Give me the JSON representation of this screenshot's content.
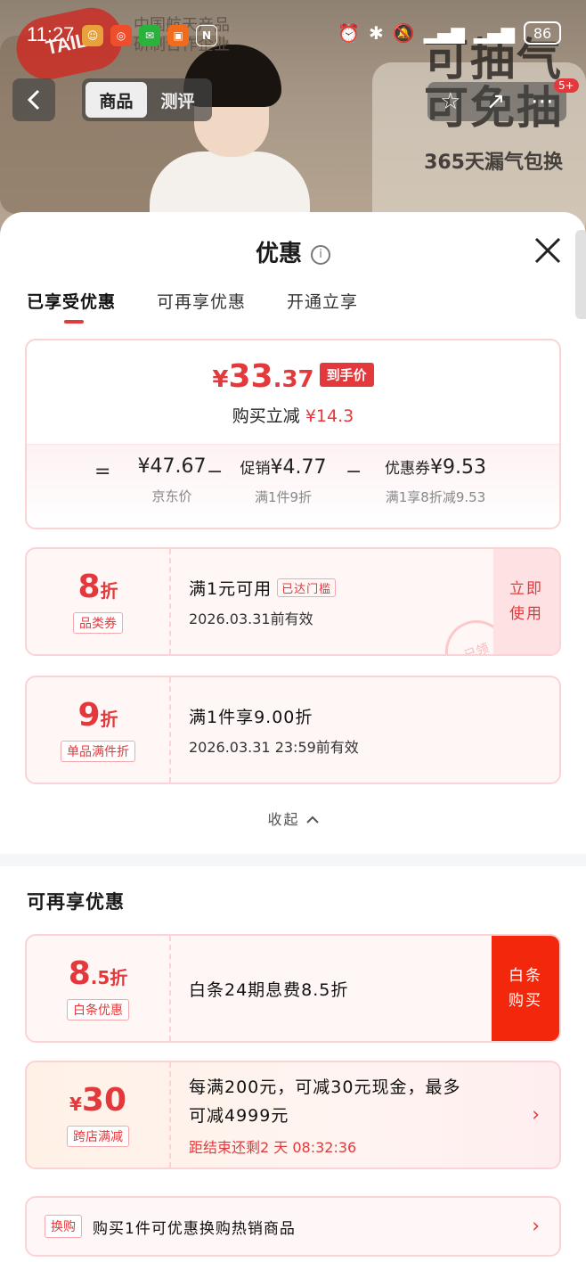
{
  "status_bar": {
    "time": "11:27",
    "battery": "86"
  },
  "background": {
    "brand_logo": "TAILI",
    "brand_line1": "中国航天产品",
    "brand_line2": "研制合作企业",
    "promo_line1": "可抽气",
    "promo_line2": "可免抽",
    "promo_line3": "365天漏气包换"
  },
  "nav": {
    "tabs": [
      {
        "label": "商品",
        "active": true
      },
      {
        "label": "测评",
        "active": false
      }
    ],
    "badge": "5+"
  },
  "sheet": {
    "title": "优惠",
    "info_icon": "i",
    "tabs": [
      {
        "label": "已享受优惠",
        "active": true
      },
      {
        "label": "可再享优惠",
        "active": false
      },
      {
        "label": "开通立享",
        "active": false
      }
    ],
    "price": {
      "currency": "¥",
      "final_int": "33",
      "final_dec": ".37",
      "final_tag": "到手价",
      "reduce_label": "购买立减",
      "reduce_value": "¥14.3",
      "eq": "=",
      "minus": "−",
      "jd_price": "¥47.67",
      "jd_label": "京东价",
      "promo_label": "促销",
      "promo_value": "¥4.77",
      "promo_desc": "满1件9折",
      "coupon_label": "优惠券",
      "coupon_value": "¥9.53",
      "coupon_desc": "满1享8折减9.53"
    },
    "coupons": [
      {
        "big": "8",
        "unit": "折",
        "kind": "品类券",
        "line1": "满1元可用",
        "reached": "已达门槛",
        "line2": "2026.03.31前有效",
        "button": "立即使用",
        "stamp": "已领"
      },
      {
        "big": "9",
        "unit": "折",
        "kind": "单品满件折",
        "line1": "满1件享9.00折",
        "line2": "2026.03.31 23:59前有效"
      }
    ],
    "collapse_label": "收起",
    "more_section_title": "可再享优惠",
    "more": [
      {
        "big": "8",
        "dec": ".5",
        "unit": "折",
        "kind": "白条优惠",
        "line1": "白条24期息费8.5折",
        "button": "白条购买"
      },
      {
        "currency": "¥",
        "big": "30",
        "kind": "跨店满减",
        "line1": "每满200元，可减30元现金，最多",
        "line1b": "可减4999元",
        "countdown": "距结束还剩2 天 08:32:36"
      }
    ],
    "swap": {
      "kind": "换购",
      "text": "购买1件可优惠换购热销商品"
    }
  },
  "colors": {
    "accent": "#e4393c",
    "baitiao": "#f2270c"
  }
}
